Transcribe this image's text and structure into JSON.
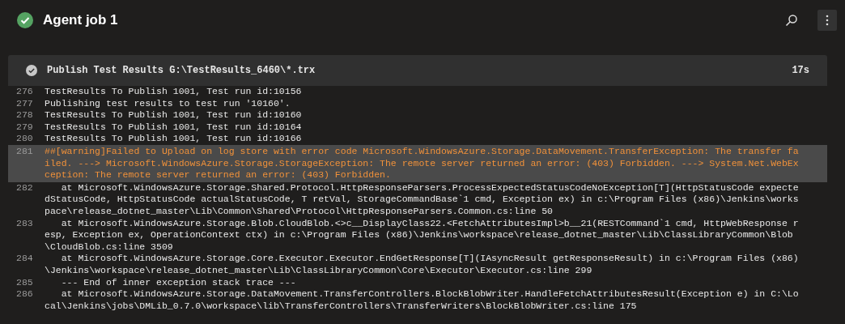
{
  "header": {
    "succeeded": true,
    "title": "Agent job 1"
  },
  "step": {
    "succeeded": true,
    "title": "Publish Test Results G:\\TestResults_6460\\*.trx",
    "duration": "17s"
  },
  "log": [
    {
      "number": "276",
      "kind": "normal",
      "lines": [
        "TestResults To Publish 1001, Test run id:10156"
      ]
    },
    {
      "number": "277",
      "kind": "normal",
      "lines": [
        "Publishing test results to test run '10160'."
      ]
    },
    {
      "number": "278",
      "kind": "normal",
      "lines": [
        "TestResults To Publish 1001, Test run id:10160"
      ]
    },
    {
      "number": "279",
      "kind": "normal",
      "lines": [
        "TestResults To Publish 1001, Test run id:10164"
      ]
    },
    {
      "number": "280",
      "kind": "normal",
      "lines": [
        "TestResults To Publish 1001, Test run id:10166"
      ]
    },
    {
      "number": "281",
      "kind": "warning",
      "lines": [
        "##[warning]Failed to Upload on log store with error code Microsoft.WindowsAzure.Storage.DataMovement.TransferException: The transfer fa",
        "iled. ---> Microsoft.WindowsAzure.Storage.StorageException: The remote server returned an error: (403) Forbidden. ---> System.Net.WebEx",
        "ception: The remote server returned an error: (403) Forbidden."
      ]
    },
    {
      "number": "282",
      "kind": "normal",
      "lines": [
        "   at Microsoft.WindowsAzure.Storage.Shared.Protocol.HttpResponseParsers.ProcessExpectedStatusCodeNoException[T](HttpStatusCode expecte",
        "dStatusCode, HttpStatusCode actualStatusCode, T retVal, StorageCommandBase`1 cmd, Exception ex) in c:\\Program Files (x86)\\Jenkins\\works",
        "pace\\release_dotnet_master\\Lib\\Common\\Shared\\Protocol\\HttpResponseParsers.Common.cs:line 50"
      ]
    },
    {
      "number": "283",
      "kind": "normal",
      "lines": [
        "   at Microsoft.WindowsAzure.Storage.Blob.CloudBlob.<>c__DisplayClass22.<FetchAttributesImpl>b__21(RESTCommand`1 cmd, HttpWebResponse r",
        "esp, Exception ex, OperationContext ctx) in c:\\Program Files (x86)\\Jenkins\\workspace\\release_dotnet_master\\Lib\\ClassLibraryCommon\\Blob",
        "\\CloudBlob.cs:line 3509"
      ]
    },
    {
      "number": "284",
      "kind": "normal",
      "lines": [
        "   at Microsoft.WindowsAzure.Storage.Core.Executor.Executor.EndGetResponse[T](IAsyncResult getResponseResult) in c:\\Program Files (x86)",
        "\\Jenkins\\workspace\\release_dotnet_master\\Lib\\ClassLibraryCommon\\Core\\Executor\\Executor.cs:line 299"
      ]
    },
    {
      "number": "285",
      "kind": "normal",
      "lines": [
        "   --- End of inner exception stack trace ---"
      ]
    },
    {
      "number": "286",
      "kind": "normal",
      "lines": [
        "   at Microsoft.WindowsAzure.Storage.DataMovement.TransferControllers.BlockBlobWriter.HandleFetchAttributesResult(Exception e) in C:\\Lo",
        "cal\\Jenkins\\jobs\\DMLib_0.7.0\\workspace\\lib\\TransferControllers\\TransferWriters\\BlockBlobWriter.cs:line 175"
      ]
    }
  ]
}
